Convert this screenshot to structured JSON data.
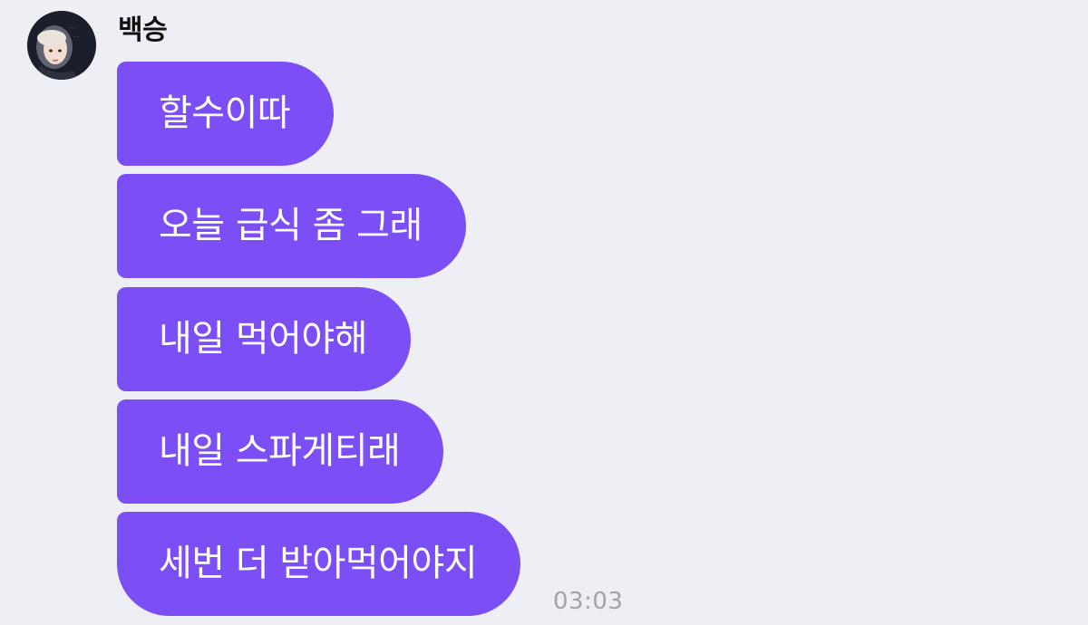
{
  "chat": {
    "sender_name": "백승",
    "avatar_icon": "profile-photo",
    "bubble_color": "#7b4ef6",
    "background_color": "#eeeef5",
    "messages": [
      {
        "text": "할수이따"
      },
      {
        "text": "오늘 급식 좀 그래"
      },
      {
        "text": "내일 먹어야해"
      },
      {
        "text": "내일 스파게티래"
      },
      {
        "text": "세번 더 받아먹어야지"
      }
    ],
    "timestamp": "03:03"
  }
}
